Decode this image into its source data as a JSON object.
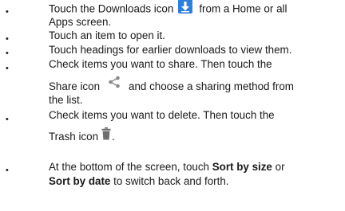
{
  "bullet_char": "•",
  "items": [
    {
      "line1_before_icon": "Touch the Downloads icon",
      "icon": "downloads-icon",
      "line1_after_icon": "from a Home or all",
      "line2": "Apps screen."
    },
    {
      "line1": "Touch an item to open it."
    },
    {
      "line1": "Touch headings for earlier downloads to view them."
    },
    {
      "line1": "Check items you want to share. Then touch the",
      "line2_before_icon": "Share icon",
      "icon": "share-icon",
      "line2_after_icon": "and choose a sharing method from",
      "line3": "the list."
    },
    {
      "line1": "Check items you want to delete. Then touch the",
      "line2_before_icon": "Trash icon",
      "icon": "trash-icon",
      "line2_after_icon": "."
    },
    {
      "line1_before_bold": "At the bottom of the screen, touch",
      "line1_bold": "Sort by size",
      "line1_after_bold": "or",
      "line2_bold": "Sort by date",
      "line2_after_bold": "to switch back and forth."
    }
  ],
  "colors": {
    "text": "#1a1a1a",
    "downloads_icon_bg": "#2f7fd9",
    "share_icon": "#8a8a8a",
    "trash_icon": "#6e6e6e"
  }
}
